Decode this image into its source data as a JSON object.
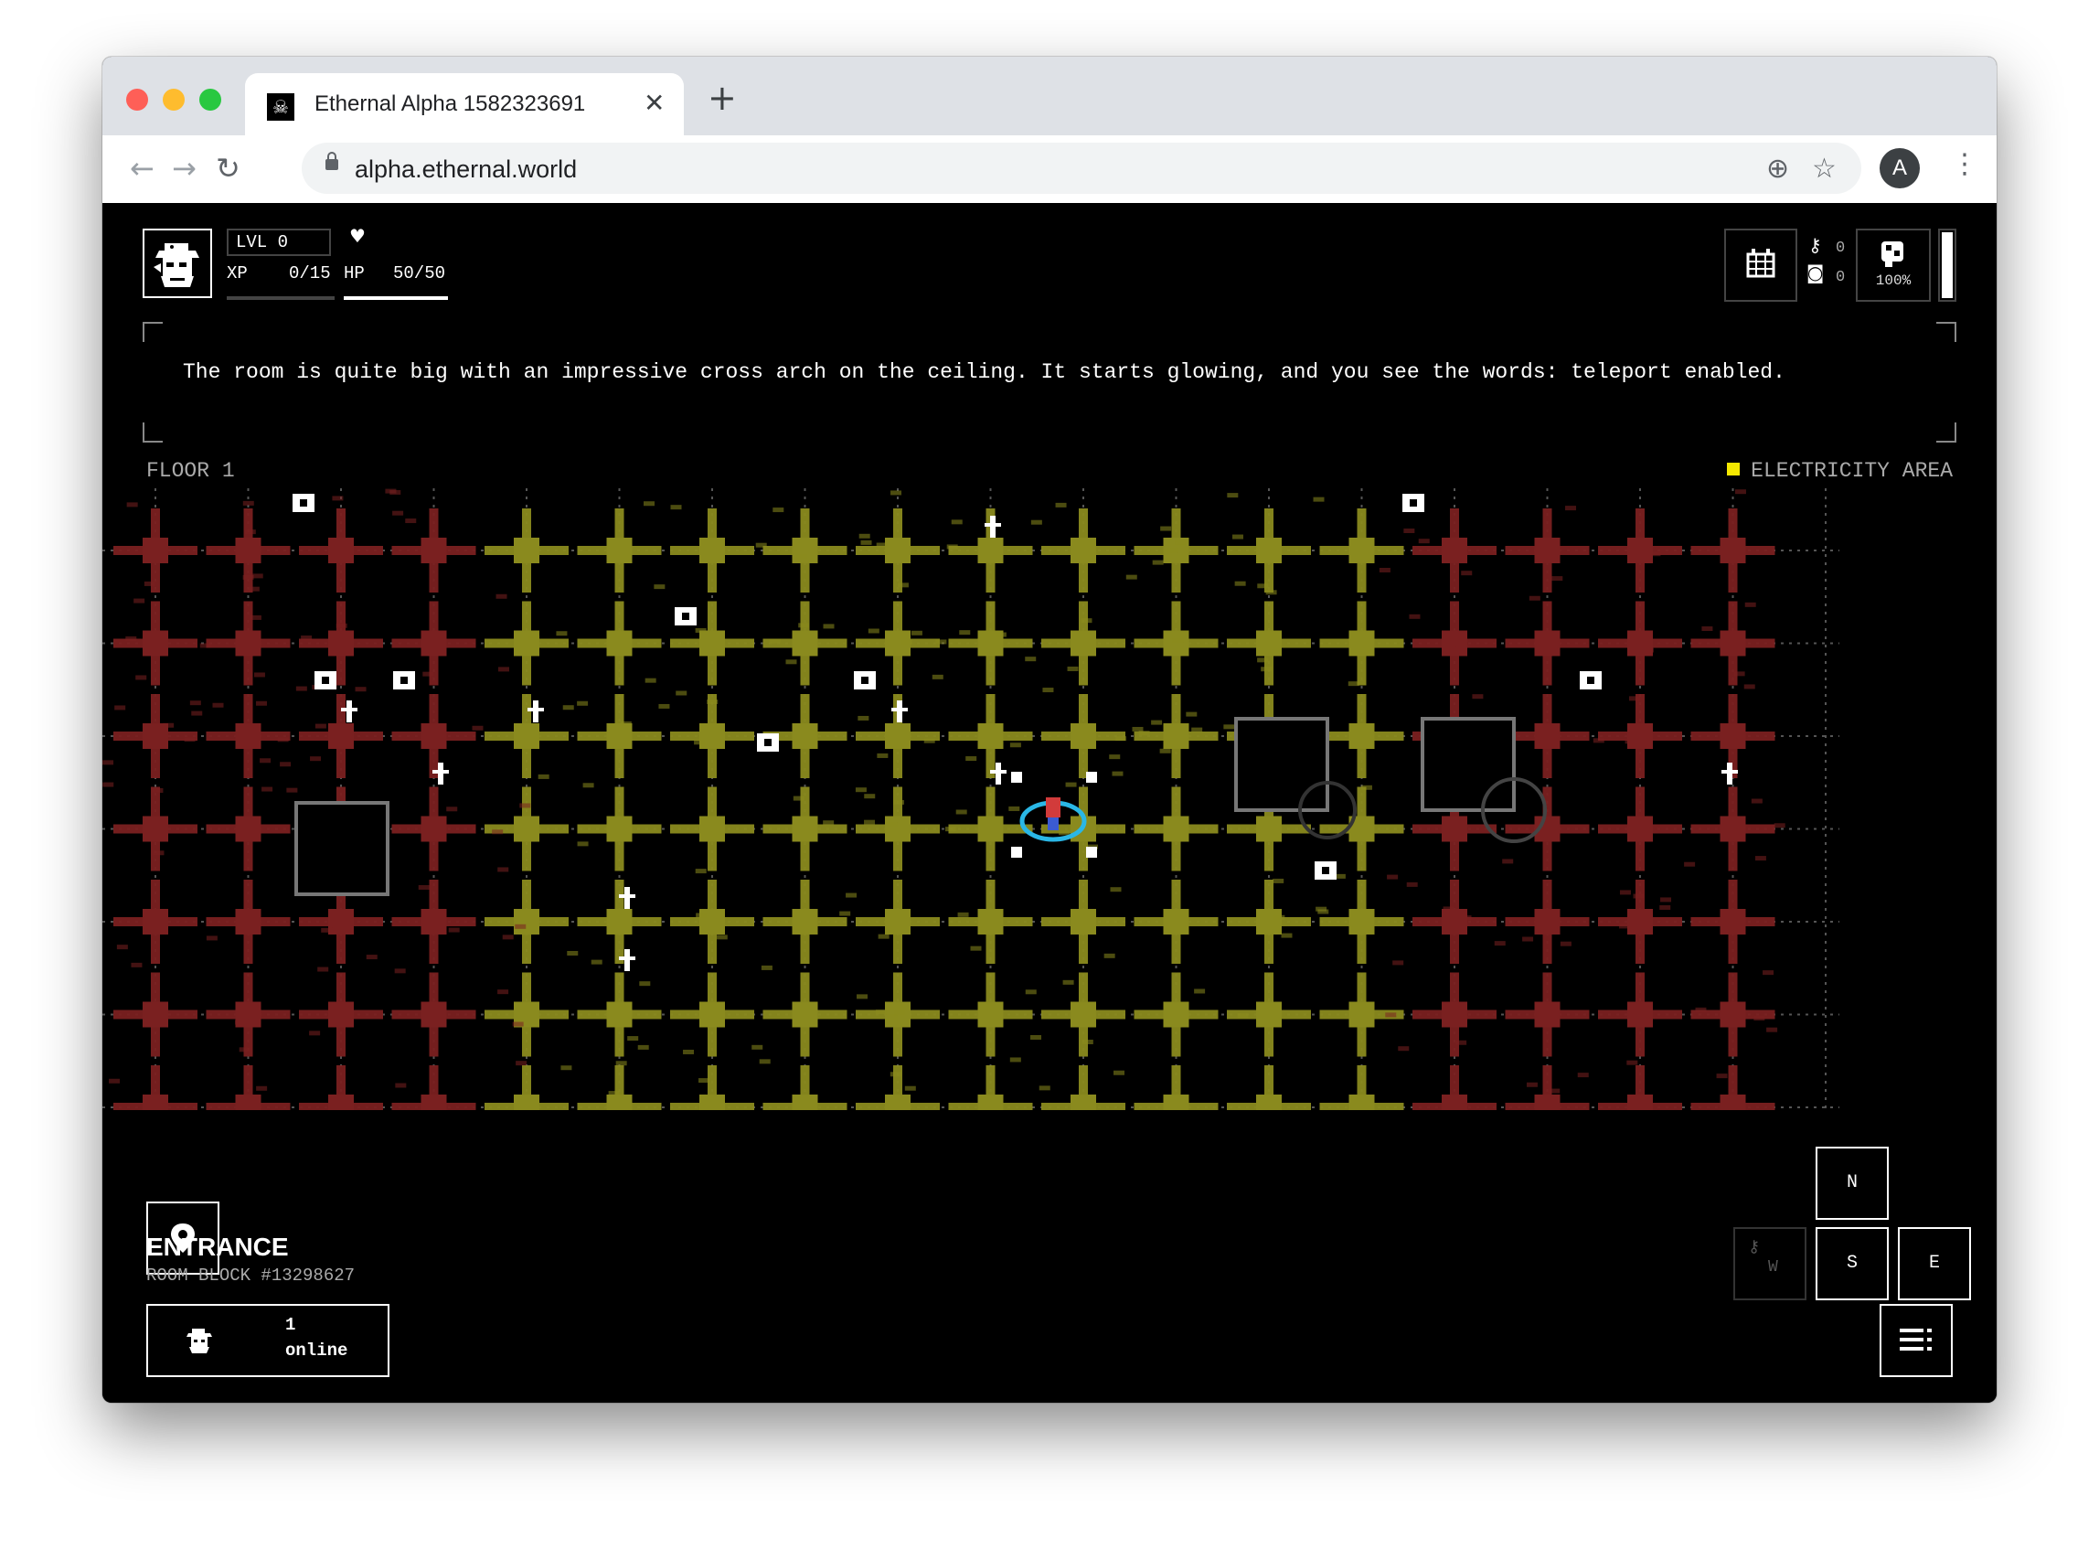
{
  "browser": {
    "tab_title": "Ethernal Alpha 1582323691",
    "tab_close": "✕",
    "new_tab": "+",
    "url": "alpha.ethernal.world",
    "avatar_letter": "A",
    "nav_back": "←",
    "nav_forward": "→",
    "nav_reload": "↻",
    "install_icon": "⊕",
    "star_icon": "☆",
    "menu_icon": "⋮"
  },
  "player": {
    "level": "LVL 0",
    "xp_label": "XP",
    "xp_value": "0/15",
    "hp_label": "HP",
    "hp_value": "50/50",
    "heart": "♥",
    "xp_fraction": 0.0,
    "hp_fraction": 1.0
  },
  "hud": {
    "keys_count": "0",
    "coins_count": "0",
    "energy": "100%",
    "energy_fraction": 1.0
  },
  "message": "The room is quite big with an impressive cross arch on the ceiling. It starts glowing, and you see the words: teleport enabled.",
  "map": {
    "floor": "FLOOR 1",
    "area": "ELECTRICITY AREA",
    "area_color": "#f5e800",
    "zone_colors": {
      "red": "#7a2020",
      "yellow": "#8a8a1e"
    }
  },
  "room": {
    "name": "ENTRANCE",
    "block": "ROOM BLOCK #13298627"
  },
  "online": {
    "count": "1",
    "label": "online"
  },
  "directions": {
    "north": "N",
    "south": "S",
    "east": "E",
    "west": "W"
  }
}
